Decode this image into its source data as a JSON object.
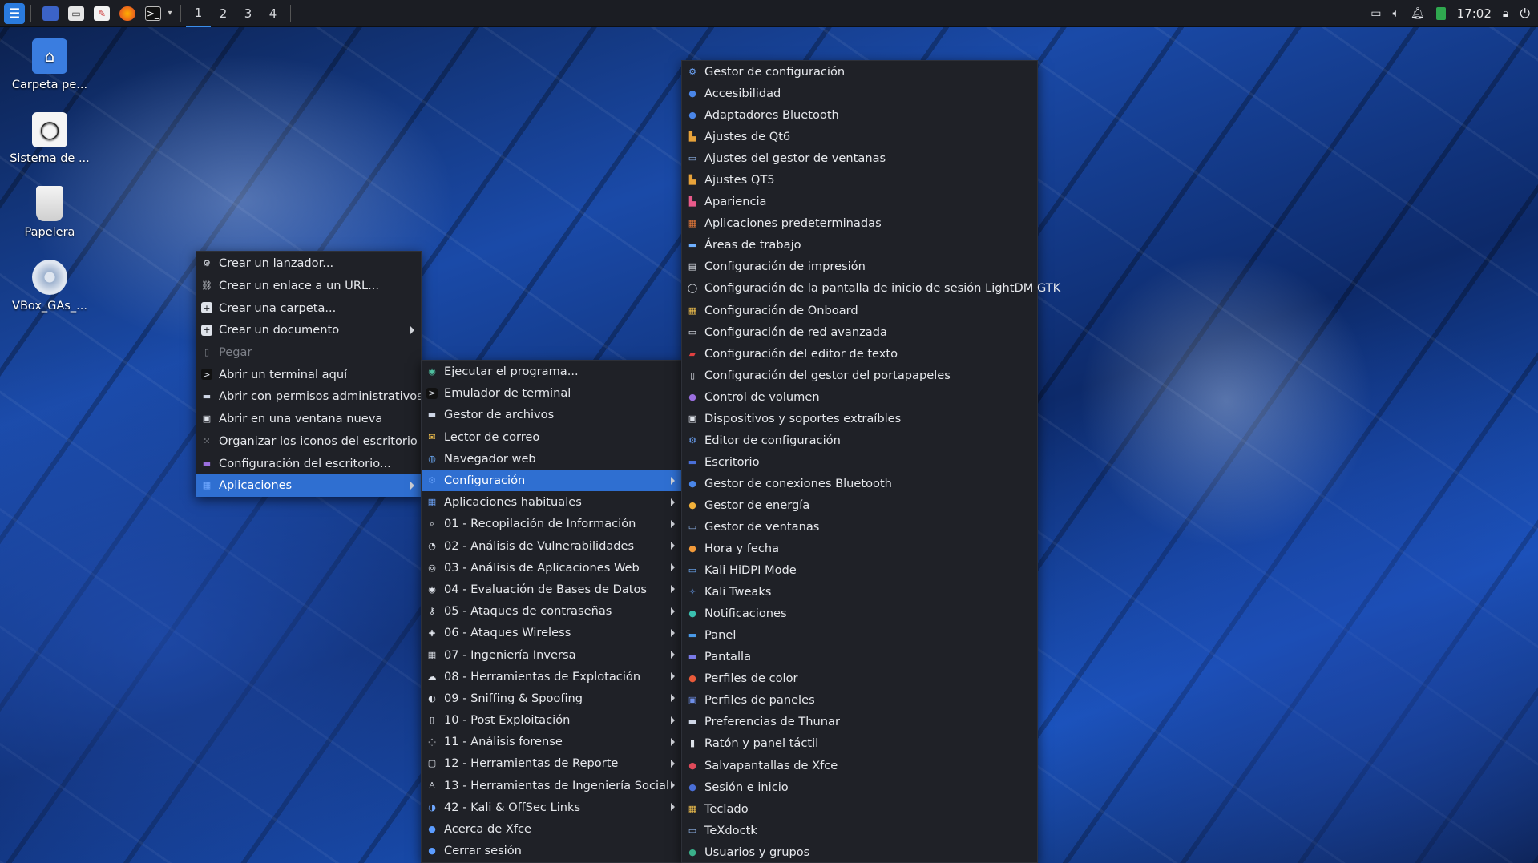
{
  "panel": {
    "launchers": [
      "kali-menu-icon",
      "desktop-icon",
      "file-manager-icon",
      "text-editor-icon",
      "firefox-icon",
      "terminal-icon"
    ],
    "workspaces": [
      "1",
      "2",
      "3",
      "4"
    ],
    "clock": "17:02"
  },
  "desktop": {
    "icons": [
      "Carpeta pe...",
      "Sistema de ...",
      "Papelera",
      "VBox_GAs_..."
    ]
  },
  "desktop_menu": {
    "items": [
      {
        "label": "Crear un lanzador...",
        "icon": "gear-icon"
      },
      {
        "label": "Crear un enlace a un URL...",
        "icon": "link-icon"
      },
      {
        "label": "Crear una carpeta...",
        "icon": "new-folder-icon"
      },
      {
        "label": "Crear un documento",
        "icon": "new-document-icon"
      },
      {
        "label": "Pegar",
        "icon": "paste-icon"
      },
      {
        "label": "Abrir un terminal aquí",
        "icon": "terminal-icon"
      },
      {
        "label": "Abrir con permisos administrativos",
        "icon": "folder-icon"
      },
      {
        "label": "Abrir en una ventana nueva",
        "icon": "window-icon"
      },
      {
        "label": "Organizar los iconos del escritorio",
        "icon": "arrange-icon"
      },
      {
        "label": "Configuración del escritorio...",
        "icon": "desktop-settings-icon"
      },
      {
        "label": "Aplicaciones",
        "icon": "applications-icon"
      }
    ]
  },
  "apps_menu": {
    "items": [
      {
        "label": "Ejecutar el programa...",
        "icon": "run-icon"
      },
      {
        "label": "Emulador de terminal",
        "icon": "terminal-icon"
      },
      {
        "label": "Gestor de archivos",
        "icon": "folder-icon"
      },
      {
        "label": "Lector de correo",
        "icon": "mail-icon"
      },
      {
        "label": "Navegador web",
        "icon": "globe-icon"
      },
      {
        "label": "Configuración",
        "icon": "settings-icon"
      },
      {
        "label": "Aplicaciones habituales",
        "icon": "applications-icon"
      },
      {
        "label": "01 - Recopilación de Información",
        "icon": "search-icon"
      },
      {
        "label": "02 - Análisis de Vulnerabilidades",
        "icon": "vulnerability-icon"
      },
      {
        "label": "03 - Análisis de Aplicaciones Web",
        "icon": "web-icon"
      },
      {
        "label": "04 - Evaluación de Bases de Datos",
        "icon": "database-icon"
      },
      {
        "label": "05 - Ataques de contraseñas",
        "icon": "key-icon"
      },
      {
        "label": "06 - Ataques Wireless",
        "icon": "wireless-icon"
      },
      {
        "label": "07 - Ingeniería Inversa",
        "icon": "reverse-icon"
      },
      {
        "label": "08 - Herramientas de Explotación",
        "icon": "exploit-icon"
      },
      {
        "label": "09 - Sniffing & Spoofing",
        "icon": "sniffing-icon"
      },
      {
        "label": "10 - Post Exploitación",
        "icon": "post-exploit-icon"
      },
      {
        "label": "11 - Análisis forense",
        "icon": "forensics-icon"
      },
      {
        "label": "12 - Herramientas de Reporte",
        "icon": "report-icon"
      },
      {
        "label": "13 - Herramientas de Ingeniería Social",
        "icon": "social-icon"
      },
      {
        "label": "42 - Kali & OffSec Links",
        "icon": "kali-icon"
      },
      {
        "label": "Acerca de Xfce",
        "icon": "info-icon"
      },
      {
        "label": "Cerrar sesión",
        "icon": "logout-icon"
      }
    ]
  },
  "settings_menu": {
    "items": [
      {
        "label": "Gestor de configuración",
        "icon": "settings-manager-icon"
      },
      {
        "label": "Accesibilidad",
        "icon": "accessibility-icon"
      },
      {
        "label": "Adaptadores Bluetooth",
        "icon": "bluetooth-icon"
      },
      {
        "label": "Ajustes de Qt6",
        "icon": "qt-icon"
      },
      {
        "label": "Ajustes del gestor de ventanas",
        "icon": "window-manager-icon"
      },
      {
        "label": "Ajustes QT5",
        "icon": "qt-icon"
      },
      {
        "label": "Apariencia",
        "icon": "appearance-icon"
      },
      {
        "label": "Aplicaciones predeterminadas",
        "icon": "default-apps-icon"
      },
      {
        "label": "Áreas de trabajo",
        "icon": "workspaces-icon"
      },
      {
        "label": "Configuración de impresión",
        "icon": "printer-icon"
      },
      {
        "label": "Configuración de la pantalla de inicio de sesión LightDM GTK",
        "icon": "login-screen-icon"
      },
      {
        "label": "Configuración de Onboard",
        "icon": "keyboard-icon"
      },
      {
        "label": "Configuración de red avanzada",
        "icon": "network-icon"
      },
      {
        "label": "Configuración del editor de texto",
        "icon": "text-editor-icon"
      },
      {
        "label": "Configuración del gestor del portapapeles",
        "icon": "clipboard-icon"
      },
      {
        "label": "Control de volumen",
        "icon": "volume-icon"
      },
      {
        "label": "Dispositivos y soportes extraíbles",
        "icon": "removable-drive-icon"
      },
      {
        "label": "Editor de configuración",
        "icon": "config-editor-icon"
      },
      {
        "label": "Escritorio",
        "icon": "desktop-icon"
      },
      {
        "label": "Gestor de conexiones Bluetooth",
        "icon": "bluetooth-icon"
      },
      {
        "label": "Gestor de energía",
        "icon": "power-icon"
      },
      {
        "label": "Gestor de ventanas",
        "icon": "window-manager-icon"
      },
      {
        "label": "Hora y fecha",
        "icon": "clock-icon"
      },
      {
        "label": "Kali HiDPI Mode",
        "icon": "hidpi-icon"
      },
      {
        "label": "Kali Tweaks",
        "icon": "kali-tweaks-icon"
      },
      {
        "label": "Notificaciones",
        "icon": "notifications-icon"
      },
      {
        "label": "Panel",
        "icon": "panel-icon"
      },
      {
        "label": "Pantalla",
        "icon": "display-icon"
      },
      {
        "label": "Perfiles de color",
        "icon": "color-profile-icon"
      },
      {
        "label": "Perfiles de paneles",
        "icon": "panel-profiles-icon"
      },
      {
        "label": "Preferencias de Thunar",
        "icon": "thunar-icon"
      },
      {
        "label": "Ratón y panel táctil",
        "icon": "mouse-icon"
      },
      {
        "label": "Salvapantallas de Xfce",
        "icon": "screensaver-icon"
      },
      {
        "label": "Sesión e inicio",
        "icon": "session-icon"
      },
      {
        "label": "Teclado",
        "icon": "keyboard-icon"
      },
      {
        "label": "TeXdoctk",
        "icon": "texdoc-icon"
      },
      {
        "label": "Usuarios y grupos",
        "icon": "users-icon"
      }
    ]
  }
}
